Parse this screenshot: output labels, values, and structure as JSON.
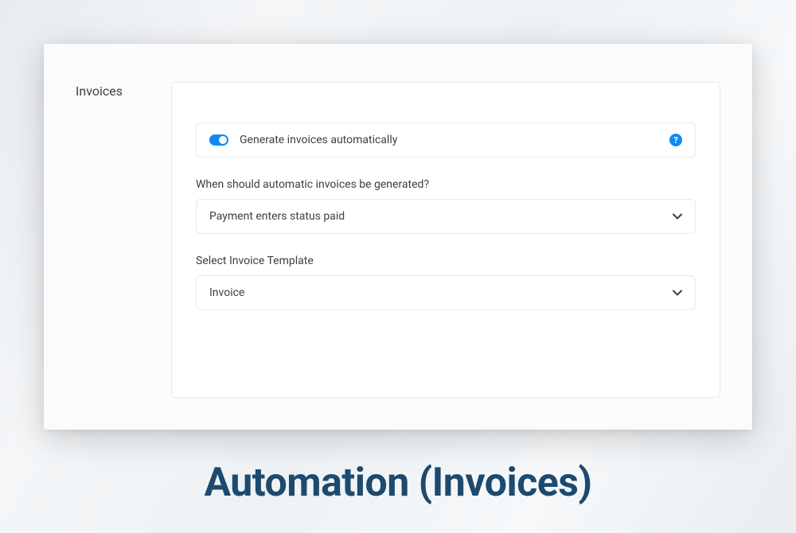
{
  "section": {
    "title": "Invoices"
  },
  "toggle": {
    "label": "Generate invoices automatically",
    "enabled": true
  },
  "fields": {
    "trigger": {
      "label": "When should automatic invoices be generated?",
      "value": "Payment enters status paid"
    },
    "template": {
      "label": "Select Invoice Template",
      "value": "Invoice"
    }
  },
  "caption": "Automation (Invoices)",
  "colors": {
    "accent": "#0d8bf2",
    "caption": "#1d4a6e"
  }
}
